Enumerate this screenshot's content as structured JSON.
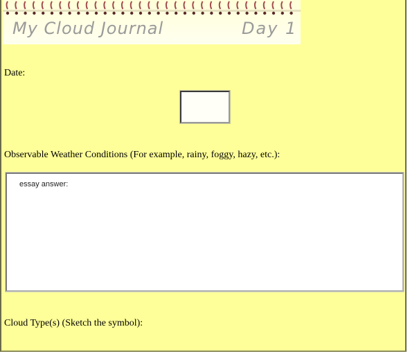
{
  "banner": {
    "title": "My Cloud Journal",
    "day": "Day 1",
    "spiral_icon": "spiral-binding-icon",
    "spiral_colors": {
      "loop": "#a04a4a",
      "hole": "#5a2a2a"
    }
  },
  "form": {
    "date_label": "Date:",
    "weather_label": "Observable Weather Conditions (For example, rainy, foggy, hazy, etc.):",
    "essay_placeholder": "essay answer:",
    "cloud_label": "Cloud Type(s) (Sketch the symbol):"
  },
  "colors": {
    "page_background": "#ffff99",
    "banner_text": "#9a9a9a"
  }
}
